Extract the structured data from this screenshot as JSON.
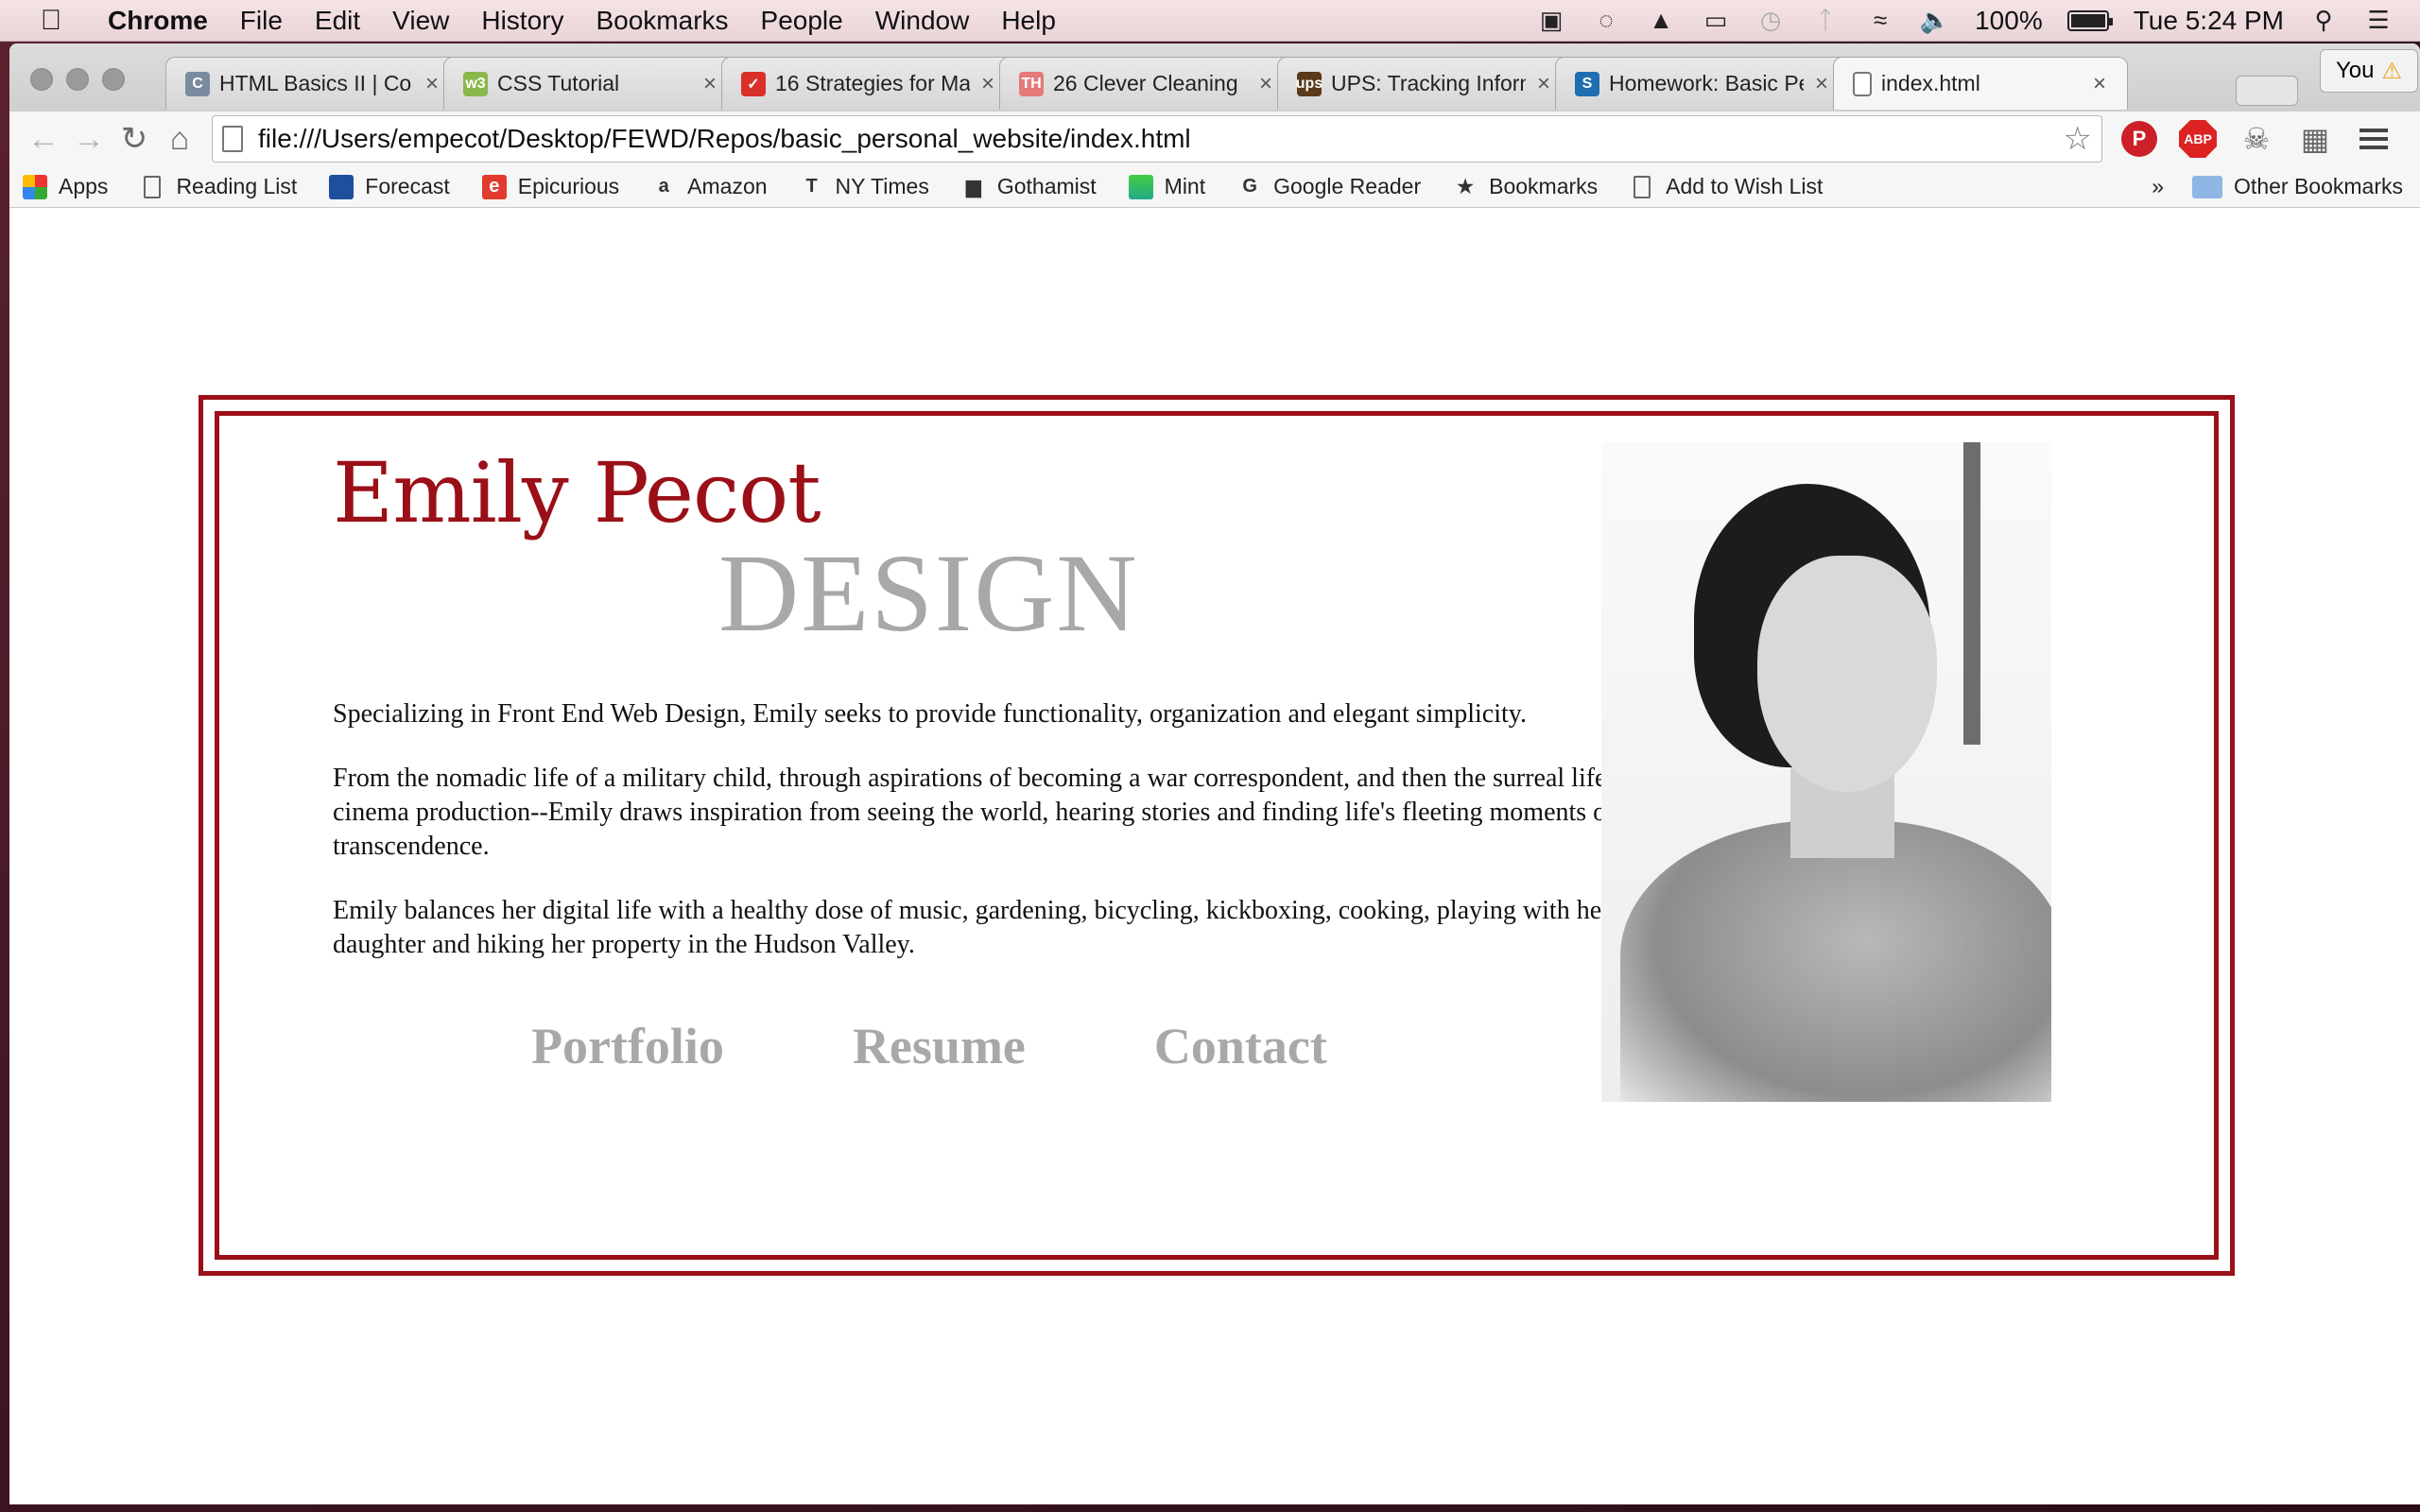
{
  "menubar": {
    "apple": "",
    "app": "Chrome",
    "items": [
      "File",
      "Edit",
      "View",
      "History",
      "Bookmarks",
      "People",
      "Window",
      "Help"
    ],
    "battery": "100%",
    "clock": "Tue 5:24 PM"
  },
  "tabs": [
    {
      "title": "HTML Basics II | Co",
      "favicon": "C",
      "color": "#7a8ba0"
    },
    {
      "title": "CSS Tutorial",
      "favicon": "w3",
      "color": "#8ab84a"
    },
    {
      "title": "16 Strategies for Ma",
      "favicon": "✓",
      "color": "#d9302a"
    },
    {
      "title": "26 Clever Cleaning",
      "favicon": "TH",
      "color": "#e47a7a"
    },
    {
      "title": "UPS: Tracking Inform",
      "favicon": "ups",
      "color": "#5a3a1a"
    },
    {
      "title": "Homework: Basic Pe",
      "favicon": "S",
      "color": "#1f6fb0"
    },
    {
      "title": "index.html",
      "favicon": "",
      "color": "#ffffff"
    }
  ],
  "profile": {
    "label": "You",
    "warning": "⚠"
  },
  "omnibox": {
    "url": "file:///Users/empecot/Desktop/FEWD/Repos/basic_personal_website/index.html"
  },
  "bookmarks": [
    {
      "label": "Apps",
      "icon": "apps-icon"
    },
    {
      "label": "Reading List",
      "icon": "document-icon"
    },
    {
      "label": "Forecast",
      "icon": "weather-icon"
    },
    {
      "label": "Epicurious",
      "icon": "epicurious-icon"
    },
    {
      "label": "Amazon",
      "icon": "amazon-icon"
    },
    {
      "label": "NY Times",
      "icon": "nytimes-icon"
    },
    {
      "label": "Gothamist",
      "icon": "gothamist-icon"
    },
    {
      "label": "Mint",
      "icon": "mint-icon"
    },
    {
      "label": "Google Reader",
      "icon": "google-icon"
    },
    {
      "label": "Bookmarks",
      "icon": "star-icon"
    },
    {
      "label": "Add to Wish List",
      "icon": "document-icon"
    }
  ],
  "bookmarks_overflow": "»",
  "other_bookmarks": "Other Bookmarks",
  "page": {
    "name": "Emily Pecot",
    "tagline": "DESIGN",
    "paragraphs": [
      "Specializing in Front End Web Design, Emily seeks to provide functionality, organization and elegant simplicity.",
      "From the nomadic life of a military child, through aspirations of becoming a war correspondent, and then the surreal life of cinema production--Emily draws inspiration from seeing the world, hearing stories and finding life's fleeting moments of transcendence.",
      "Emily balances her digital life with a healthy dose of music, gardening, bicycling, kickboxing, cooking, playing with her daughter and hiking her property in the Hudson Valley."
    ],
    "nav": [
      "Portfolio",
      "Resume",
      "Contact"
    ],
    "accent_color": "#9b0f17",
    "muted_color": "#a8a8a8"
  }
}
